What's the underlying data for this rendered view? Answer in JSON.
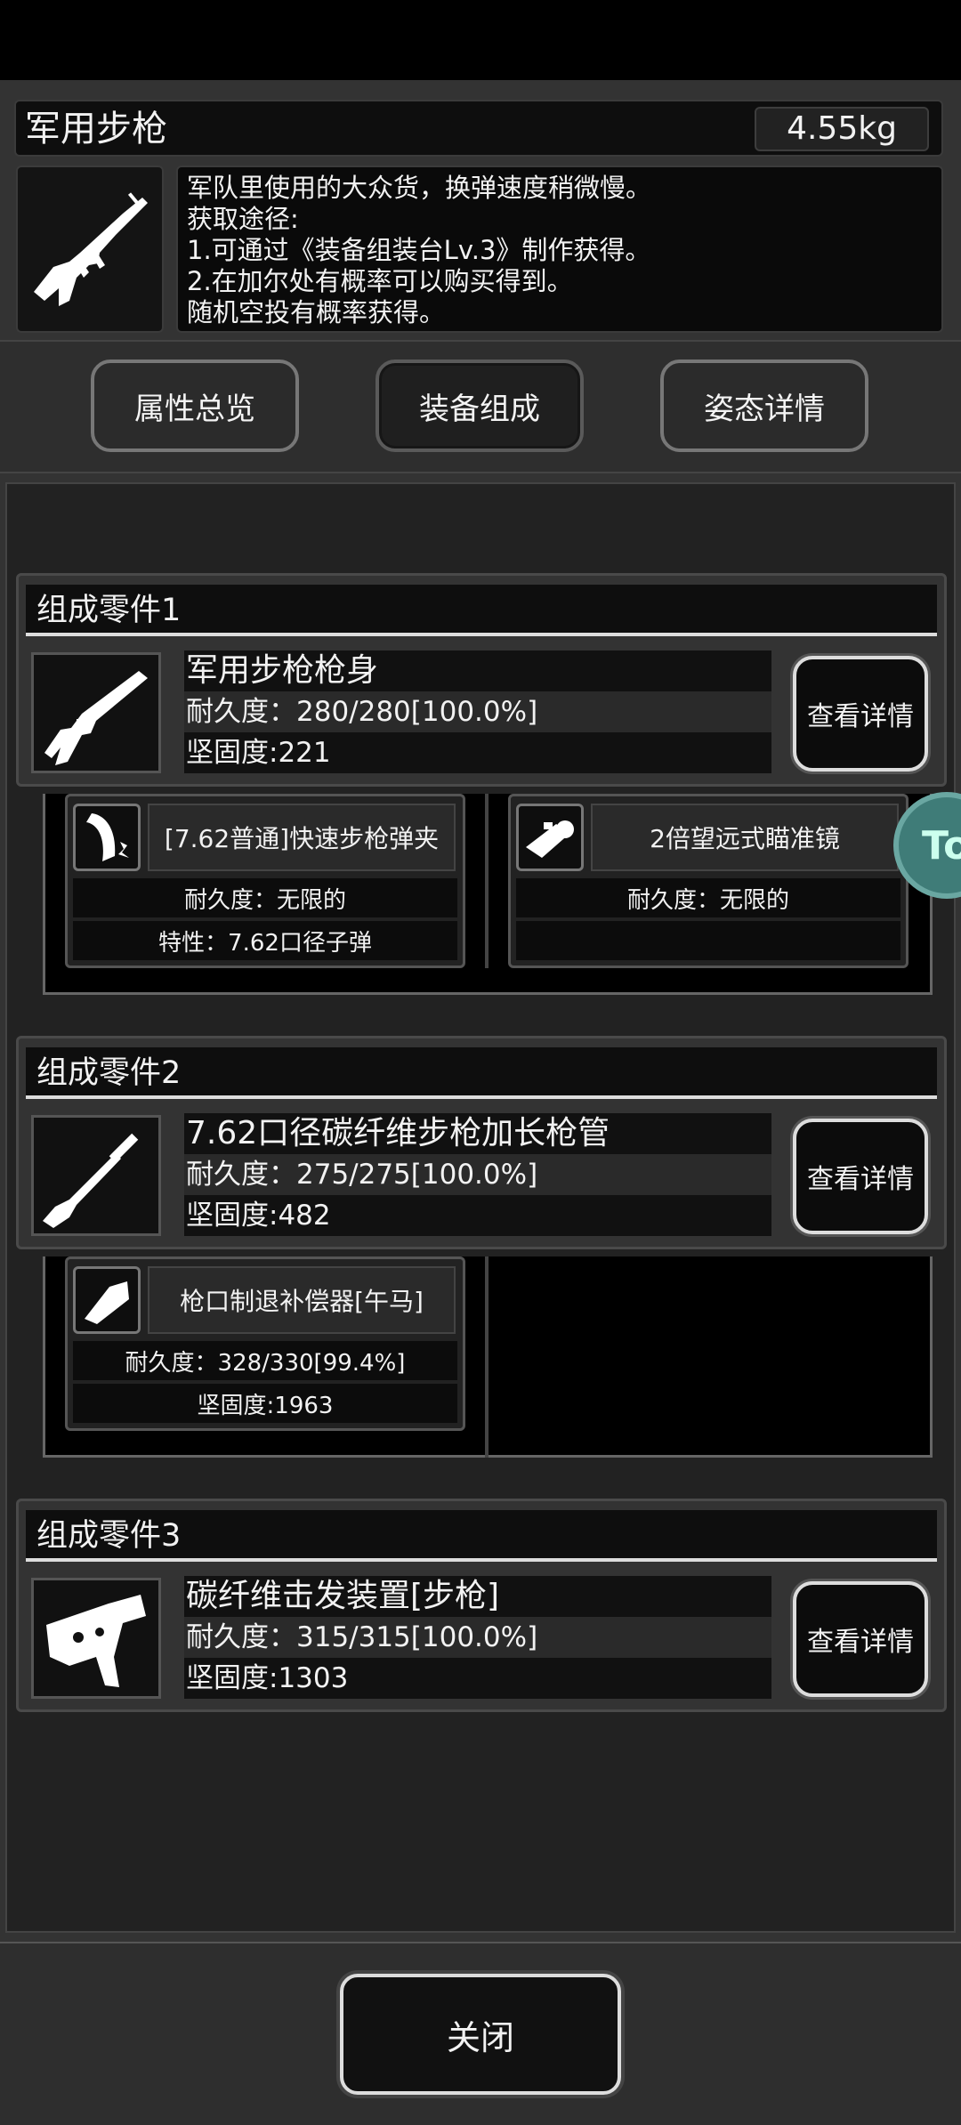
{
  "header": {
    "title": "军用步枪",
    "weight": "4.55kg"
  },
  "description": {
    "lines": [
      "军队里使用的大众货，换弹速度稍微慢。",
      "获取途径:",
      "1.可通过《装备组装台Lv.3》制作获得。",
      "2.在加尔处有概率可以购买得到。",
      "随机空投有概率获得。"
    ]
  },
  "tabs": [
    {
      "label": "属性总览"
    },
    {
      "label": "装备组成"
    },
    {
      "label": "姿态详情"
    }
  ],
  "parts": [
    {
      "title": "组成零件1",
      "name": "军用步枪枪身",
      "durability": "耐久度：280/280[100.0%]",
      "hardness": "坚固度:221",
      "detail_label": "查看详情"
    },
    {
      "title": "组成零件2",
      "name": "7.62口径碳纤维步枪加长枪管",
      "durability": "耐久度：275/275[100.0%]",
      "hardness": "坚固度:482",
      "detail_label": "查看详情"
    },
    {
      "title": "组成零件3",
      "name": "碳纤维击发装置[步枪]",
      "durability": "耐久度：315/315[100.0%]",
      "hardness": "坚固度:1303",
      "detail_label": "查看详情"
    }
  ],
  "mods": [
    {
      "name": "[7.62普通]快速步枪弹夹",
      "line1": "耐久度：无限的",
      "line2": "特性：7.62口径子弹"
    },
    {
      "name": "2倍望远式瞄准镜",
      "line1": "耐久度：无限的",
      "line2": ""
    },
    {
      "name": "枪口制退补偿器[午马]",
      "line1": "耐久度：328/330[99.4%]",
      "line2": "坚固度:1963"
    }
  ],
  "close_label": "关闭",
  "float_button": "To"
}
